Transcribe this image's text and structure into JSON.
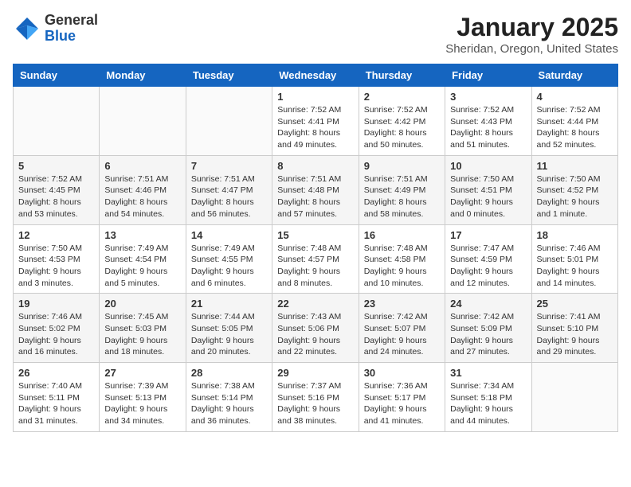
{
  "header": {
    "logo_general": "General",
    "logo_blue": "Blue",
    "month_title": "January 2025",
    "location": "Sheridan, Oregon, United States"
  },
  "days_of_week": [
    "Sunday",
    "Monday",
    "Tuesday",
    "Wednesday",
    "Thursday",
    "Friday",
    "Saturday"
  ],
  "weeks": [
    [
      {
        "day": "",
        "content": ""
      },
      {
        "day": "",
        "content": ""
      },
      {
        "day": "",
        "content": ""
      },
      {
        "day": "1",
        "content": "Sunrise: 7:52 AM\nSunset: 4:41 PM\nDaylight: 8 hours\nand 49 minutes."
      },
      {
        "day": "2",
        "content": "Sunrise: 7:52 AM\nSunset: 4:42 PM\nDaylight: 8 hours\nand 50 minutes."
      },
      {
        "day": "3",
        "content": "Sunrise: 7:52 AM\nSunset: 4:43 PM\nDaylight: 8 hours\nand 51 minutes."
      },
      {
        "day": "4",
        "content": "Sunrise: 7:52 AM\nSunset: 4:44 PM\nDaylight: 8 hours\nand 52 minutes."
      }
    ],
    [
      {
        "day": "5",
        "content": "Sunrise: 7:52 AM\nSunset: 4:45 PM\nDaylight: 8 hours\nand 53 minutes."
      },
      {
        "day": "6",
        "content": "Sunrise: 7:51 AM\nSunset: 4:46 PM\nDaylight: 8 hours\nand 54 minutes."
      },
      {
        "day": "7",
        "content": "Sunrise: 7:51 AM\nSunset: 4:47 PM\nDaylight: 8 hours\nand 56 minutes."
      },
      {
        "day": "8",
        "content": "Sunrise: 7:51 AM\nSunset: 4:48 PM\nDaylight: 8 hours\nand 57 minutes."
      },
      {
        "day": "9",
        "content": "Sunrise: 7:51 AM\nSunset: 4:49 PM\nDaylight: 8 hours\nand 58 minutes."
      },
      {
        "day": "10",
        "content": "Sunrise: 7:50 AM\nSunset: 4:51 PM\nDaylight: 9 hours\nand 0 minutes."
      },
      {
        "day": "11",
        "content": "Sunrise: 7:50 AM\nSunset: 4:52 PM\nDaylight: 9 hours\nand 1 minute."
      }
    ],
    [
      {
        "day": "12",
        "content": "Sunrise: 7:50 AM\nSunset: 4:53 PM\nDaylight: 9 hours\nand 3 minutes."
      },
      {
        "day": "13",
        "content": "Sunrise: 7:49 AM\nSunset: 4:54 PM\nDaylight: 9 hours\nand 5 minutes."
      },
      {
        "day": "14",
        "content": "Sunrise: 7:49 AM\nSunset: 4:55 PM\nDaylight: 9 hours\nand 6 minutes."
      },
      {
        "day": "15",
        "content": "Sunrise: 7:48 AM\nSunset: 4:57 PM\nDaylight: 9 hours\nand 8 minutes."
      },
      {
        "day": "16",
        "content": "Sunrise: 7:48 AM\nSunset: 4:58 PM\nDaylight: 9 hours\nand 10 minutes."
      },
      {
        "day": "17",
        "content": "Sunrise: 7:47 AM\nSunset: 4:59 PM\nDaylight: 9 hours\nand 12 minutes."
      },
      {
        "day": "18",
        "content": "Sunrise: 7:46 AM\nSunset: 5:01 PM\nDaylight: 9 hours\nand 14 minutes."
      }
    ],
    [
      {
        "day": "19",
        "content": "Sunrise: 7:46 AM\nSunset: 5:02 PM\nDaylight: 9 hours\nand 16 minutes."
      },
      {
        "day": "20",
        "content": "Sunrise: 7:45 AM\nSunset: 5:03 PM\nDaylight: 9 hours\nand 18 minutes."
      },
      {
        "day": "21",
        "content": "Sunrise: 7:44 AM\nSunset: 5:05 PM\nDaylight: 9 hours\nand 20 minutes."
      },
      {
        "day": "22",
        "content": "Sunrise: 7:43 AM\nSunset: 5:06 PM\nDaylight: 9 hours\nand 22 minutes."
      },
      {
        "day": "23",
        "content": "Sunrise: 7:42 AM\nSunset: 5:07 PM\nDaylight: 9 hours\nand 24 minutes."
      },
      {
        "day": "24",
        "content": "Sunrise: 7:42 AM\nSunset: 5:09 PM\nDaylight: 9 hours\nand 27 minutes."
      },
      {
        "day": "25",
        "content": "Sunrise: 7:41 AM\nSunset: 5:10 PM\nDaylight: 9 hours\nand 29 minutes."
      }
    ],
    [
      {
        "day": "26",
        "content": "Sunrise: 7:40 AM\nSunset: 5:11 PM\nDaylight: 9 hours\nand 31 minutes."
      },
      {
        "day": "27",
        "content": "Sunrise: 7:39 AM\nSunset: 5:13 PM\nDaylight: 9 hours\nand 34 minutes."
      },
      {
        "day": "28",
        "content": "Sunrise: 7:38 AM\nSunset: 5:14 PM\nDaylight: 9 hours\nand 36 minutes."
      },
      {
        "day": "29",
        "content": "Sunrise: 7:37 AM\nSunset: 5:16 PM\nDaylight: 9 hours\nand 38 minutes."
      },
      {
        "day": "30",
        "content": "Sunrise: 7:36 AM\nSunset: 5:17 PM\nDaylight: 9 hours\nand 41 minutes."
      },
      {
        "day": "31",
        "content": "Sunrise: 7:34 AM\nSunset: 5:18 PM\nDaylight: 9 hours\nand 44 minutes."
      },
      {
        "day": "",
        "content": ""
      }
    ]
  ]
}
